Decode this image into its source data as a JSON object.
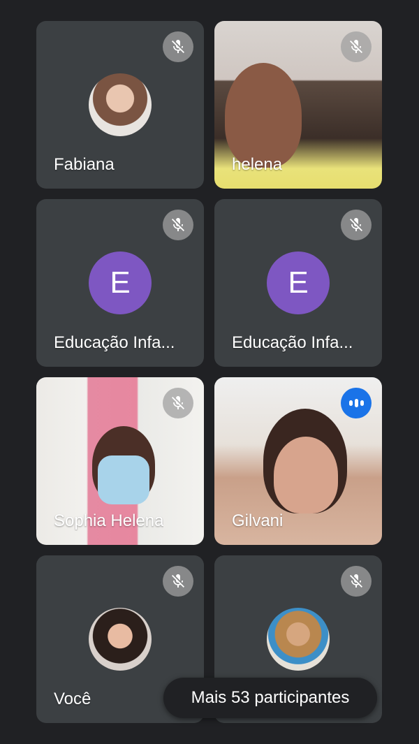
{
  "participants": [
    {
      "name": "Fabiana",
      "muted": true,
      "type": "photo-avatar",
      "icon": "mic-off-icon"
    },
    {
      "name": "helena",
      "muted": true,
      "type": "video",
      "icon": "mic-off-icon"
    },
    {
      "name": "Educação Infa...",
      "muted": true,
      "type": "letter-avatar",
      "letter": "E",
      "icon": "mic-off-icon"
    },
    {
      "name": "Educação Infa...",
      "muted": true,
      "type": "letter-avatar",
      "letter": "E",
      "icon": "mic-off-icon"
    },
    {
      "name": "Sophia Helena",
      "muted": true,
      "type": "video",
      "icon": "mic-off-icon"
    },
    {
      "name": "Gilvani",
      "muted": false,
      "speaking": true,
      "type": "video",
      "icon": "speaking-indicator-icon"
    },
    {
      "name": "Você",
      "muted": true,
      "type": "photo-avatar",
      "icon": "mic-off-icon"
    },
    {
      "name": "",
      "muted": true,
      "type": "photo-avatar",
      "icon": "mic-off-icon"
    }
  ],
  "more_participants_label": "Mais 53 participantes",
  "colors": {
    "background": "#202124",
    "tile": "#3c4043",
    "letter_avatar": "#7e57c2",
    "speaking": "#1a73e8"
  }
}
